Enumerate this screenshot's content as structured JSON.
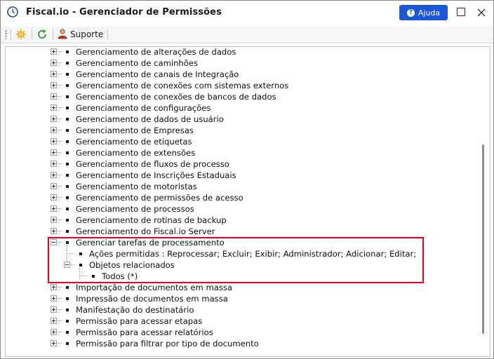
{
  "window": {
    "title": "Fiscal.io - Gerenciador de Permissões",
    "help_label": "Ajuda"
  },
  "toolbar": {
    "support_label": "Suporte"
  },
  "tree": {
    "rows": [
      {
        "label": "Gerenciamento de alterações de dados",
        "level": 0,
        "expander": "plus"
      },
      {
        "label": "Gerenciamento de caminhões",
        "level": 0,
        "expander": "plus"
      },
      {
        "label": "Gerenciamento de canais de Integração",
        "level": 0,
        "expander": "plus"
      },
      {
        "label": "Gerenciamento de conexões com sistemas externos",
        "level": 0,
        "expander": "plus"
      },
      {
        "label": "Gerenciamento de conexões de bancos de dados",
        "level": 0,
        "expander": "plus"
      },
      {
        "label": "Gerenciamento de configurações",
        "level": 0,
        "expander": "plus"
      },
      {
        "label": "Gerenciamento de dados de usuário",
        "level": 0,
        "expander": "plus"
      },
      {
        "label": "Gerenciamento de Empresas",
        "level": 0,
        "expander": "plus"
      },
      {
        "label": "Gerenciamento de etiquetas",
        "level": 0,
        "expander": "plus"
      },
      {
        "label": "Gerenciamento de extensões",
        "level": 0,
        "expander": "plus"
      },
      {
        "label": "Gerenciamento de fluxos de processo",
        "level": 0,
        "expander": "plus"
      },
      {
        "label": "Gerenciamento de Inscrições Estaduais",
        "level": 0,
        "expander": "plus"
      },
      {
        "label": "Gerenciamento de motoristas",
        "level": 0,
        "expander": "plus"
      },
      {
        "label": "Gerenciamento de permissões de acesso",
        "level": 0,
        "expander": "plus"
      },
      {
        "label": "Gerenciamento de processos",
        "level": 0,
        "expander": "plus"
      },
      {
        "label": "Gerenciamento de rotinas de backup",
        "level": 0,
        "expander": "plus"
      },
      {
        "label": "Gerenciamento do Fiscal.io Server",
        "level": 0,
        "expander": "plus"
      },
      {
        "label": "Gerenciar tarefas de processamento",
        "level": 0,
        "expander": "minus"
      },
      {
        "label": "Ações permitidas : Reprocessar; Excluir; Exibir; Administrador; Adicionar; Editar;",
        "level": 1,
        "expander": "none"
      },
      {
        "label": "Objetos relacionados",
        "level": 1,
        "expander": "minus"
      },
      {
        "label": "Todos (*)",
        "level": 2,
        "expander": "none"
      },
      {
        "label": "Importação de documentos em massa",
        "level": 0,
        "expander": "plus"
      },
      {
        "label": "Impressão de documentos em massa",
        "level": 0,
        "expander": "plus"
      },
      {
        "label": "Manifestação do destinatário",
        "level": 0,
        "expander": "plus"
      },
      {
        "label": "Permissão para acessar etapas",
        "level": 0,
        "expander": "plus"
      },
      {
        "label": "Permissão para acessar relatórios",
        "level": 0,
        "expander": "plus"
      },
      {
        "label": "Permissão para filtrar por tipo de documento",
        "level": 0,
        "expander": "plus"
      }
    ]
  },
  "icons": {
    "app": "clock-icon",
    "help": "question-icon",
    "maximize": "maximize-icon",
    "close": "close-icon",
    "toolbar_first": "sun-gear-icon",
    "toolbar_second": "refresh-icon",
    "support": "user-icon"
  },
  "colors": {
    "help_button": "#1a58d8",
    "highlight_border": "#e0001b",
    "title_text": "#1b1b1b"
  }
}
